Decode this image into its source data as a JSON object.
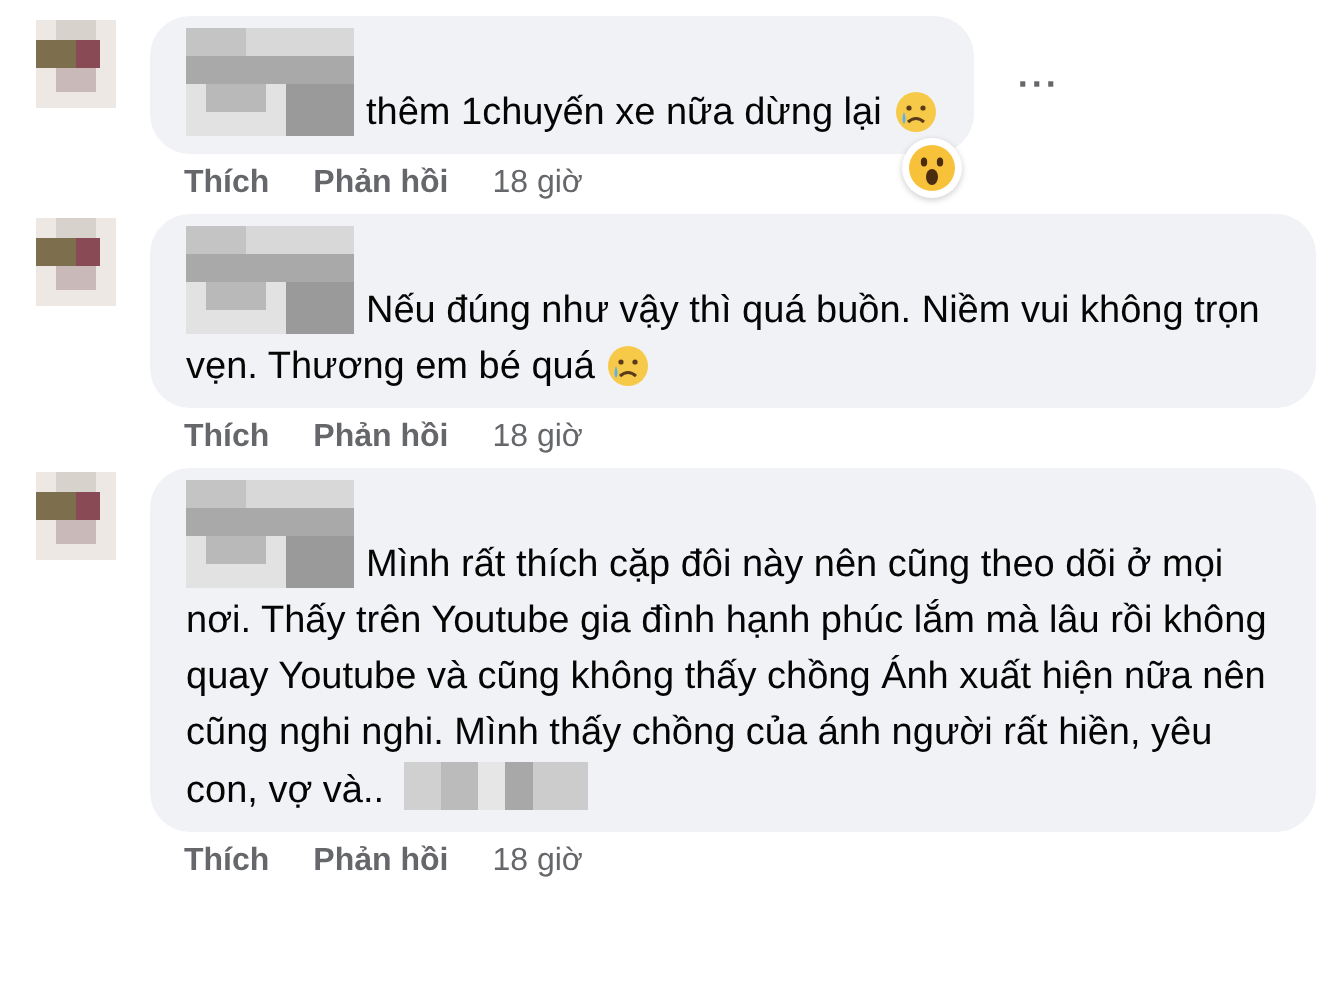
{
  "comments": [
    {
      "text": "thêm 1chuyến xe nữa dừng lại",
      "trailing_emoji": true,
      "trailing_blur": false,
      "reaction": true,
      "actions": {
        "like": "Thích",
        "reply": "Phản hồi",
        "time": "18 giờ"
      },
      "more": "···"
    },
    {
      "text": "Nếu đúng như vậy thì quá buồn. Niềm vui không trọn vẹn. Thương em bé quá",
      "trailing_emoji": true,
      "trailing_blur": false,
      "reaction": false,
      "actions": {
        "like": "Thích",
        "reply": "Phản hồi",
        "time": "18 giờ"
      }
    },
    {
      "text": "Mình rất thích cặp đôi này nên cũng theo dõi ở mọi nơi. Thấy trên Youtube gia đình hạnh phúc lắm mà lâu rồi không quay Youtube và cũng không thấy chồng Ánh xuất hiện nữa nên cũng nghi nghi. Mình thấy chồng của ánh người rất hiền, yêu con, vợ và..",
      "trailing_emoji": false,
      "trailing_blur": true,
      "reaction": false,
      "actions": {
        "like": "Thích",
        "reply": "Phản hồi",
        "time": "18 giờ"
      }
    }
  ]
}
